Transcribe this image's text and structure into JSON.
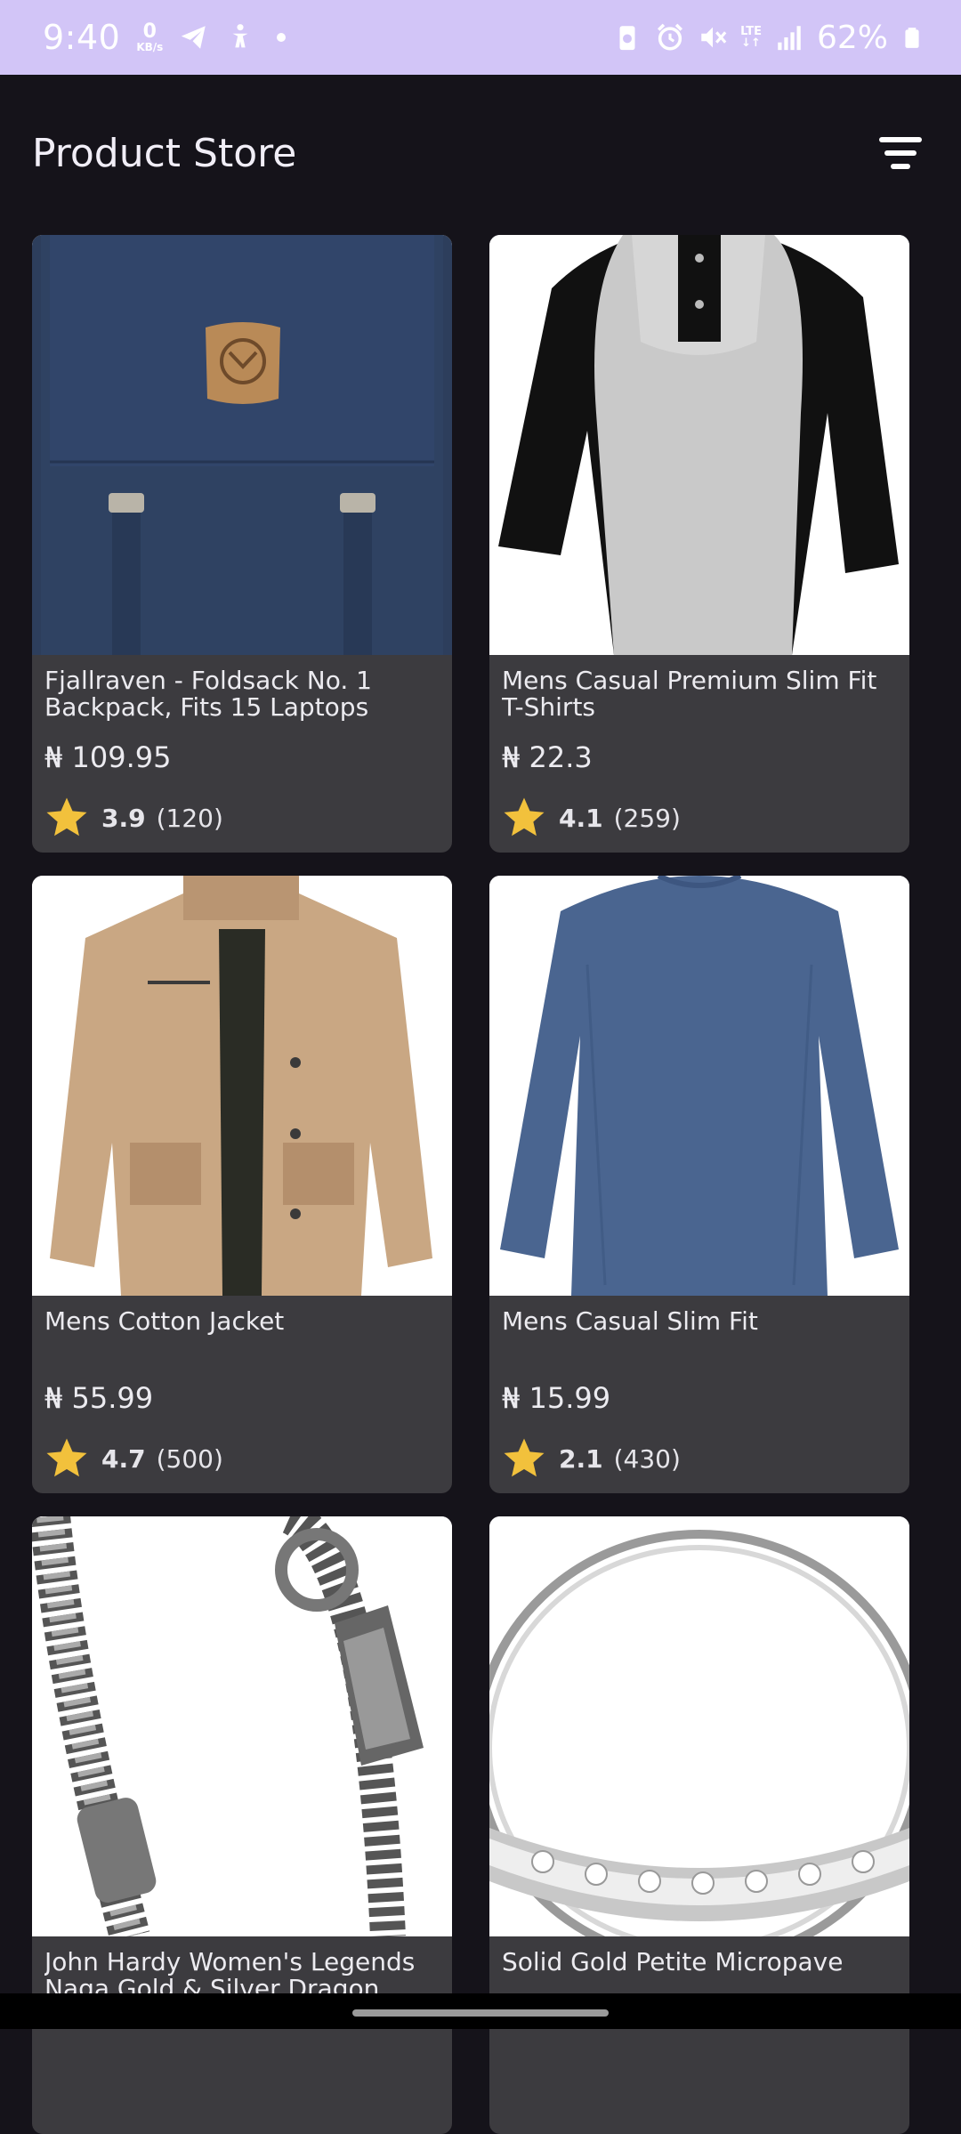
{
  "status_bar": {
    "time": "9:40",
    "speed_value": "0",
    "speed_unit": "KB/s",
    "lte": "LTE",
    "battery": "62%",
    "icons": [
      "telegram-icon",
      "accessibility-icon",
      "battery-saver-icon",
      "alarm-icon",
      "mute-icon",
      "lte-icon",
      "signal-icon",
      "battery-icon"
    ],
    "background": "#d2c5f7"
  },
  "app_bar": {
    "title": "Product Store",
    "filter_icon": "filter-icon"
  },
  "products": [
    {
      "title": "Fjallraven - Foldsack No. 1 Backpack, Fits 15 Laptops",
      "price": "₦ 109.95",
      "rating": "3.9",
      "count": "(120)",
      "image": "backpack"
    },
    {
      "title": "Mens Casual Premium Slim Fit T-Shirts",
      "price": "₦ 22.3",
      "rating": "4.1",
      "count": "(259)",
      "image": "raglan-shirt"
    },
    {
      "title": "Mens Cotton Jacket",
      "price": "₦ 55.99",
      "rating": "4.7",
      "count": "(500)",
      "image": "jacket"
    },
    {
      "title": "Mens Casual Slim Fit",
      "price": "₦ 15.99",
      "rating": "2.1",
      "count": "(430)",
      "image": "long-sleeve-shirt"
    },
    {
      "title": "John Hardy Women's Legends Naga Gold & Silver Dragon Station Chain Bracelet",
      "price": "",
      "rating": "",
      "count": "",
      "image": "bracelet"
    },
    {
      "title": "Solid Gold Petite Micropave",
      "price": "",
      "rating": "",
      "count": "",
      "image": "ring"
    }
  ],
  "colors": {
    "background": "#15131a",
    "card": "#3c3b3f",
    "star": "#f2c13c"
  }
}
